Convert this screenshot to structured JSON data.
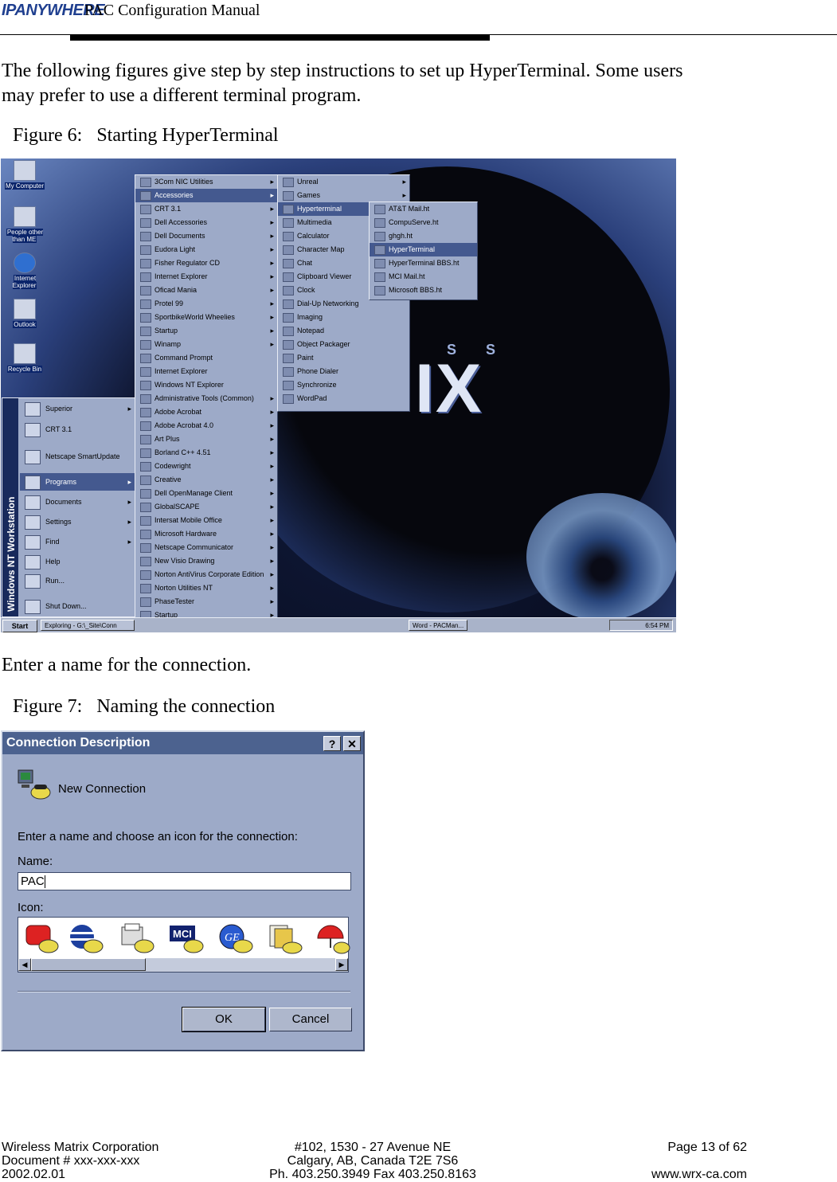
{
  "header": {
    "logo": "IPANYWHERE",
    "title": "PAC Configuration Manual"
  },
  "intro_line1": "The following figures give step by step instructions to set up HyperTerminal.  Some users",
  "intro_line2": "may prefer to use a different terminal program.",
  "figure6": {
    "caption": "Figure 6:   Starting HyperTerminal",
    "desktop_icons": [
      "My Computer",
      "People other than ME",
      "Internet Explorer",
      "Outlook",
      "Recycle Bin"
    ],
    "start_menu": {
      "band": "Windows NT Workstation",
      "items": [
        "Superior",
        "CRT 3.1",
        "Netscape SmartUpdate",
        "Programs",
        "Documents",
        "Settings",
        "Find",
        "Help",
        "Run...",
        "Shut Down..."
      ]
    },
    "programs_menu": [
      "3Com NIC Utilities",
      "Accessories",
      "CRT 3.1",
      "Dell Accessories",
      "Dell Documents",
      "Eudora Light",
      "Fisher Regulator CD",
      "Internet Explorer",
      "Oficad Mania",
      "Protel 99",
      "SportbikeWorld Wheelies",
      "Startup",
      "Winamp",
      "Command Prompt",
      "Internet Explorer",
      "Windows NT Explorer",
      "Administrative Tools (Common)",
      "Adobe Acrobat",
      "Adobe Acrobat 4.0",
      "Art Plus",
      "Borland C++ 4.51",
      "Codewright",
      "Creative",
      "Dell OpenManage Client",
      "GlobalSCAPE",
      "Intersat Mobile Office",
      "Microsoft Hardware",
      "Netscape Communicator",
      "New Visio Drawing",
      "Norton AntiVirus Corporate Edition",
      "Norton Utilities NT",
      "PhaseTester",
      "Startup"
    ],
    "accessories_menu": [
      "Unreal",
      "Games",
      "Hyperterminal",
      "Multimedia",
      "Calculator",
      "Character Map",
      "Chat",
      "Clipboard Viewer",
      "Clock",
      "Dial-Up Networking",
      "Imaging",
      "Notepad",
      "Object Packager",
      "Paint",
      "Phone Dialer",
      "Synchronize",
      "WordPad"
    ],
    "hyperterminal_menu": [
      "AT&T Mail.ht",
      "CompuServe.ht",
      "ghgh.ht",
      "HyperTerminal",
      "HyperTerminal BBS.ht",
      "MCI Mail.ht",
      "Microsoft BBS.ht"
    ],
    "taskbar": {
      "start": "Start",
      "task1": "Exploring - G:\\_Site\\Conn",
      "task2": "Word - PACMan...",
      "clock": "6:54 PM"
    }
  },
  "connection_line": "Enter a name for the connection.",
  "figure7": {
    "caption": "Figure 7:   Naming the connection",
    "dialog_title": "Connection Description",
    "help_btn": "?",
    "close_btn": "✕",
    "new_connection": "New Connection",
    "prompt": "Enter a name and choose an icon for the connection:",
    "name_label": "Name:",
    "name_value": "PAC",
    "icon_label": "Icon:",
    "ok": "OK",
    "cancel": "Cancel"
  },
  "footer": {
    "company": "Wireless Matrix Corporation",
    "document": "Document # xxx-xxx-xxx",
    "date": "2002.02.01",
    "address1": "#102, 1530 - 27 Avenue NE",
    "address2": "Calgary, AB, Canada  T2E 7S6",
    "phone": "Ph. 403.250.3949  Fax 403.250.8163",
    "page": "Page 13 of 62",
    "web": "www.wrx-ca.com"
  },
  "colors": {
    "menu_bg": "#9daac8",
    "menu_highlight": "#44598f",
    "title_bar": "#4c628f"
  }
}
